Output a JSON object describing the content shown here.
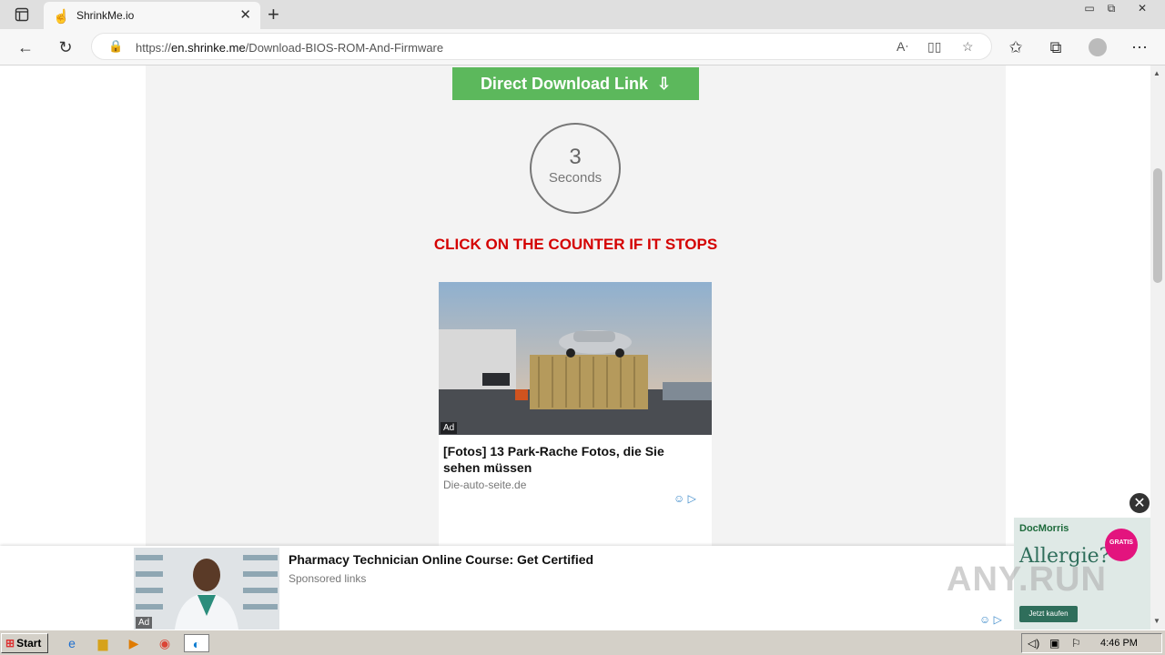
{
  "browser": {
    "tab": {
      "title": "ShrinkMe.io",
      "favicon": "hand-icon"
    },
    "address": {
      "url_domain": "en.shrinke.me",
      "url_prefix": "https://",
      "url_path": "/Download-BIOS-ROM-And-Firmware"
    }
  },
  "page": {
    "download_button": "Direct Download Link",
    "counter": {
      "value": "3",
      "unit": "Seconds"
    },
    "notice": "CLICK ON THE COUNTER IF IT STOPS",
    "ad": {
      "badge": "Ad",
      "title": "[Fotos] 13 Park-Rache Fotos, die Sie sehen müssen",
      "source": "Die-auto-seite.de"
    }
  },
  "bottom_ad": {
    "badge": "Ad",
    "title": "Pharmacy Technician Online Course: Get Certified",
    "subtitle": "Sponsored links"
  },
  "side_ad": {
    "brand": "DocMorris",
    "headline": "Allergie?",
    "badge": "GRATIS",
    "button": "Jetzt kaufen"
  },
  "watermark": "ANY.RUN",
  "taskbar": {
    "start_label": "Start",
    "clock": "4:46 PM"
  }
}
